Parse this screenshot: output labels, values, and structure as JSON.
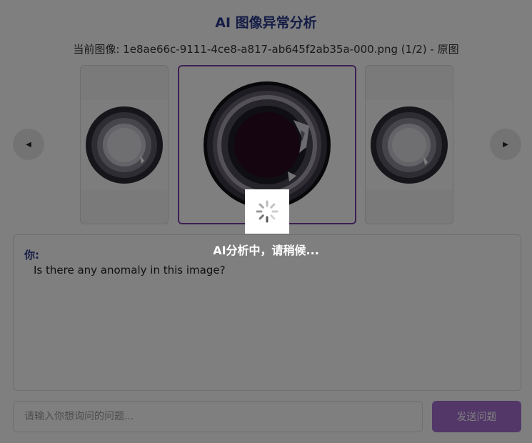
{
  "header": {
    "title": "AI 图像异常分析",
    "current_image": "当前图像: 1e8ae66c-9111-4ce8-a817-ab645f2ab35a-000.png (1/2) - 原图"
  },
  "carousel": {
    "prev_icon": "chevron-left-icon",
    "next_icon": "chevron-right-icon",
    "prev_glyph": "◀",
    "next_glyph": "▶",
    "selected_border_color": "#7b3fa8"
  },
  "chat": {
    "role_label": "你:",
    "message": "Is there any anomaly in this image?",
    "role_color": "#2b3a8c"
  },
  "composer": {
    "placeholder": "请输入你想询问的问题...",
    "value": "",
    "send_label": "发送问题",
    "send_color": "#a46fd0"
  },
  "loading": {
    "text": "AI分析中，请稍候...",
    "icon": "spinner-icon"
  }
}
